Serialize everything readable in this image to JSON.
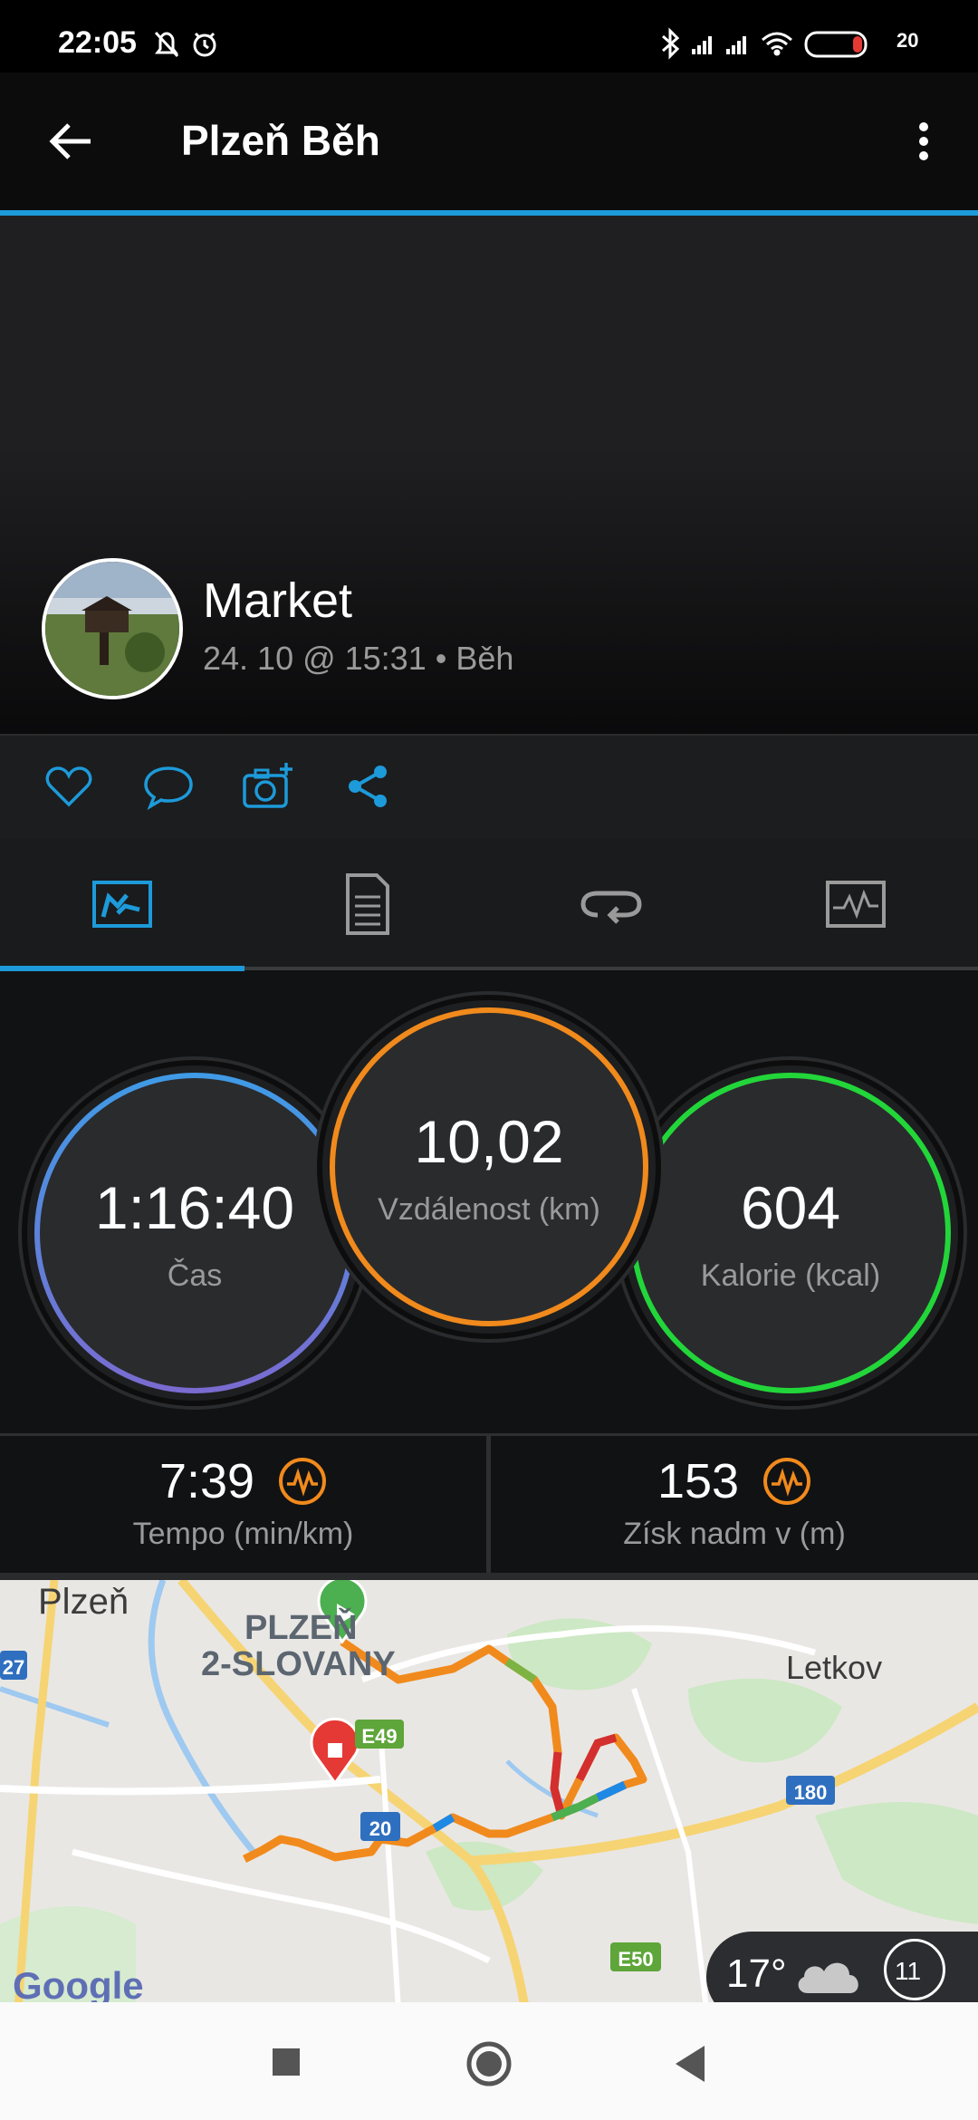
{
  "status_bar": {
    "time": "22:05",
    "battery": "20",
    "icons": [
      "bell-off-icon",
      "alarm-icon",
      "bluetooth-icon",
      "signal-icon",
      "signal-icon",
      "wifi-icon",
      "battery-icon"
    ]
  },
  "app_bar": {
    "title": "Plzeň Běh"
  },
  "activity": {
    "name": "Market",
    "subtitle": "24. 10 @ 15:31 • Běh"
  },
  "stats": {
    "time": {
      "value": "1:16:40",
      "label": "Čas"
    },
    "distance": {
      "value": "10,02",
      "label": "Vzdálenost (km)"
    },
    "calories": {
      "value": "604",
      "label": "Kalorie (kcal)"
    },
    "pace": {
      "value": "7:39",
      "label": "Tempo (min/km)"
    },
    "elevation": {
      "value": "153",
      "label": "Získ nadm v (m)"
    }
  },
  "map": {
    "labels": {
      "city": "Plzeň",
      "district1": "PLZEŇ",
      "district2": "2-SLOVANY",
      "town": "Letkov",
      "road_e49": "E49",
      "road_20": "20",
      "road_27": "27",
      "road_180": "180",
      "road_e50": "E50",
      "google": "Google"
    },
    "weather": {
      "temp": "17°",
      "wind": "11"
    }
  },
  "colors": {
    "accent": "#1d9ad9",
    "orange": "#f18a1c",
    "green": "#22d63a",
    "blue_ring": "#3f9be6"
  }
}
